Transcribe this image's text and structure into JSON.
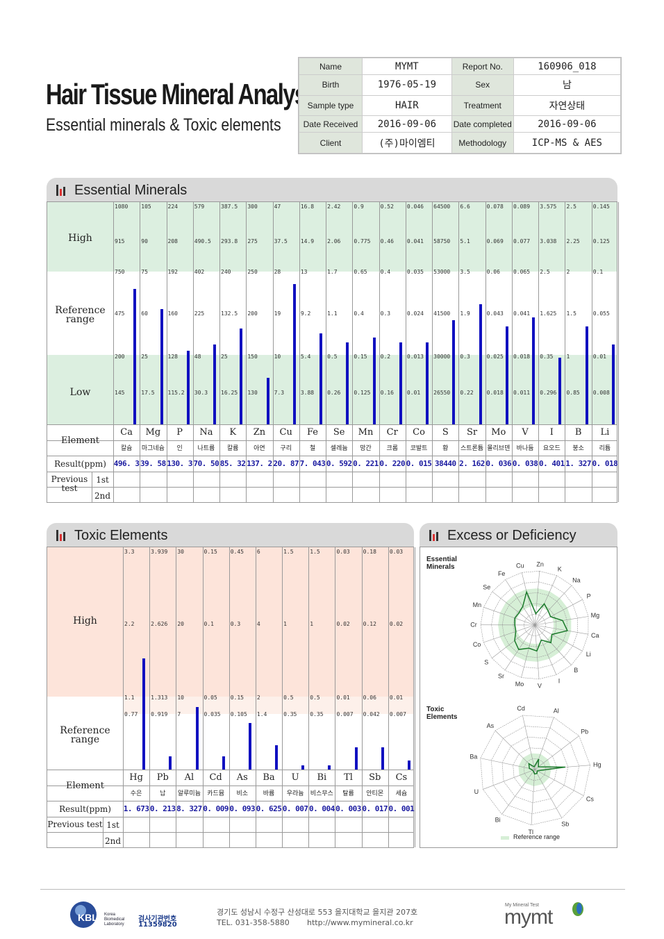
{
  "header": {
    "title": "Hair Tissue Mineral Analysis",
    "subtitle": "Essential minerals & Toxic elements"
  },
  "info": {
    "name_label": "Name",
    "name": "MYMT",
    "report_label": "Report No.",
    "report": "160906_018",
    "birth_label": "Birth",
    "birth": "1976-05-19",
    "sex_label": "Sex",
    "sex": "남",
    "sample_label": "Sample type",
    "sample": "HAIR",
    "treatment_label": "Treatment",
    "treatment": "자연상태",
    "received_label": "Date Received",
    "received": "2016-09-06",
    "completed_label": "Date completed",
    "completed": "2016-09-06",
    "client_label": "Client",
    "client": "(주)마이엠티",
    "method_label": "Methodology",
    "method": "ICP-MS & AES"
  },
  "essential": {
    "section_title": "Essential Minerals",
    "row_high": "High",
    "row_ref": "Reference range",
    "row_low": "Low",
    "row_element": "Element",
    "row_result": "Result(ppm)",
    "row_prev": "Previous test",
    "prev_1": "1st",
    "prev_2": "2nd",
    "elements": [
      {
        "sym": "Ca",
        "kor": "칼슘",
        "ticks": [
          "1080",
          "915",
          "750",
          "475",
          "200",
          "145"
        ],
        "result": "496. 3",
        "level": 0.61
      },
      {
        "sym": "Mg",
        "kor": "마그네슘",
        "ticks": [
          "105",
          "90",
          "75",
          "60",
          "25",
          "17.5"
        ],
        "result": "39. 58",
        "level": 0.52
      },
      {
        "sym": "P",
        "kor": "인",
        "ticks": [
          "224",
          "208",
          "192",
          "160",
          "128",
          "115.2"
        ],
        "result": "130. 3",
        "level": 0.33
      },
      {
        "sym": "Na",
        "kor": "나트륨",
        "ticks": [
          "579",
          "490.5",
          "402",
          "225",
          "48",
          "30.3"
        ],
        "result": "70. 50",
        "level": 0.36
      },
      {
        "sym": "K",
        "kor": "칼륨",
        "ticks": [
          "387.5",
          "293.8",
          "240",
          "132.5",
          "25",
          "16.25"
        ],
        "result": "85. 32",
        "level": 0.43
      },
      {
        "sym": "Zn",
        "kor": "아연",
        "ticks": [
          "300",
          "275",
          "250",
          "200",
          "150",
          "130"
        ],
        "result": "137. 2",
        "level": 0.21
      },
      {
        "sym": "Cu",
        "kor": "구리",
        "ticks": [
          "47",
          "37.5",
          "28",
          "19",
          "10",
          "7.3"
        ],
        "result": "20. 87",
        "level": 0.63
      },
      {
        "sym": "Fe",
        "kor": "철",
        "ticks": [
          "16.8",
          "14.9",
          "13",
          "9.2",
          "5.4",
          "3.88"
        ],
        "result": "7. 043",
        "level": 0.41
      },
      {
        "sym": "Se",
        "kor": "셀레늄",
        "ticks": [
          "2.42",
          "2.06",
          "1.7",
          "1.1",
          "0.5",
          "0.26"
        ],
        "result": "0. 592",
        "level": 0.37
      },
      {
        "sym": "Mn",
        "kor": "망간",
        "ticks": [
          "0.9",
          "0.775",
          "0.65",
          "0.4",
          "0.15",
          "0.125"
        ],
        "result": "0. 221",
        "level": 0.39
      },
      {
        "sym": "Cr",
        "kor": "크롬",
        "ticks": [
          "0.52",
          "0.46",
          "0.4",
          "0.3",
          "0.2",
          "0.16"
        ],
        "result": "0. 220",
        "level": 0.37
      },
      {
        "sym": "Co",
        "kor": "코발트",
        "ticks": [
          "0.046",
          "0.041",
          "0.035",
          "0.024",
          "0.013",
          "0.01"
        ],
        "result": "0. 015",
        "level": 0.37
      },
      {
        "sym": "S",
        "kor": "황",
        "ticks": [
          "64500",
          "58750",
          "53000",
          "41500",
          "30000",
          "26550"
        ],
        "result": "38440",
        "level": 0.47
      },
      {
        "sym": "Sr",
        "kor": "스트론튬",
        "ticks": [
          "6.6",
          "5.1",
          "3.5",
          "1.9",
          "0.3",
          "0.22"
        ],
        "result": "2. 162",
        "level": 0.54
      },
      {
        "sym": "Mo",
        "kor": "몰리브덴",
        "ticks": [
          "0.078",
          "0.069",
          "0.06",
          "0.043",
          "0.025",
          "0.018"
        ],
        "result": "0. 036",
        "level": 0.44
      },
      {
        "sym": "V",
        "kor": "바나듐",
        "ticks": [
          "0.089",
          "0.077",
          "0.065",
          "0.041",
          "0.018",
          "0.011"
        ],
        "result": "0. 038",
        "level": 0.48
      },
      {
        "sym": "I",
        "kor": "요오드",
        "ticks": [
          "3.575",
          "3.038",
          "2.5",
          "1.625",
          "0.35",
          "0.296"
        ],
        "result": "0. 401",
        "level": 0.3
      },
      {
        "sym": "B",
        "kor": "붕소",
        "ticks": [
          "2.5",
          "2.25",
          "2",
          "1.5",
          "1",
          "0.85"
        ],
        "result": "1. 327",
        "level": 0.44
      },
      {
        "sym": "Li",
        "kor": "리튬",
        "ticks": [
          "0.145",
          "0.125",
          "0.1",
          "0.055",
          "0.01",
          "0.008"
        ],
        "result": "0. 018",
        "level": 0.36
      }
    ]
  },
  "toxic": {
    "section_title": "Toxic Elements",
    "row_high": "High",
    "row_ref": "Reference range",
    "row_element": "Element",
    "row_result": "Result(ppm)",
    "row_prev": "Previous test",
    "prev_1": "1st",
    "prev_2": "2nd",
    "elements": [
      {
        "sym": "Hg",
        "kor": "수은",
        "ticks": [
          "3.3",
          "2.2",
          "1.1",
          "0.77"
        ],
        "result": "1. 673",
        "level": 0.5
      },
      {
        "sym": "Pb",
        "kor": "납",
        "ticks": [
          "3.939",
          "2.626",
          "1.313",
          "0.919"
        ],
        "result": "0. 213",
        "level": 0.06
      },
      {
        "sym": "Al",
        "kor": "알루미늄",
        "ticks": [
          "30",
          "20",
          "10",
          "7"
        ],
        "result": "8. 327",
        "level": 0.28
      },
      {
        "sym": "Cd",
        "kor": "카드뮴",
        "ticks": [
          "0.15",
          "0.1",
          "0.05",
          "0.035"
        ],
        "result": "0. 009",
        "level": 0.06
      },
      {
        "sym": "As",
        "kor": "비소",
        "ticks": [
          "0.45",
          "0.3",
          "0.15",
          "0.105"
        ],
        "result": "0. 093",
        "level": 0.21
      },
      {
        "sym": "Ba",
        "kor": "바륨",
        "ticks": [
          "6",
          "4",
          "2",
          "1.4"
        ],
        "result": "0. 625",
        "level": 0.11
      },
      {
        "sym": "U",
        "kor": "우라늄",
        "ticks": [
          "1.5",
          "1",
          "0.5",
          "0.35"
        ],
        "result": "0. 007",
        "level": 0.02
      },
      {
        "sym": "Bi",
        "kor": "비스무스",
        "ticks": [
          "1.5",
          "1",
          "0.5",
          "0.35"
        ],
        "result": "0. 004",
        "level": 0.02
      },
      {
        "sym": "Tl",
        "kor": "탈륨",
        "ticks": [
          "0.03",
          "0.02",
          "0.01",
          "0.007"
        ],
        "result": "0. 003",
        "level": 0.1
      },
      {
        "sym": "Sb",
        "kor": "안티몬",
        "ticks": [
          "0.18",
          "0.12",
          "0.06",
          "0.042"
        ],
        "result": "0. 017",
        "level": 0.1
      },
      {
        "sym": "Cs",
        "kor": "세슘",
        "ticks": [
          "0.03",
          "0.02",
          "0.01",
          "0.007"
        ],
        "result": "0. 001",
        "level": 0.04
      }
    ]
  },
  "excess": {
    "section_title": "Excess or Deficiency",
    "essential_label": "Essential Minerals",
    "toxic_label": "Toxic Elements",
    "legend": "Reference range",
    "essential_axes": [
      "Zn",
      "K",
      "Na",
      "P",
      "Mg",
      "Ca",
      "Li",
      "B",
      "I",
      "V",
      "Mo",
      "Sr",
      "S",
      "Co",
      "Cr",
      "Mn",
      "Se",
      "Fe",
      "Cu"
    ],
    "essential_values": [
      0.21,
      0.43,
      0.36,
      0.33,
      0.52,
      0.61,
      0.36,
      0.44,
      0.3,
      0.48,
      0.44,
      0.54,
      0.47,
      0.37,
      0.37,
      0.39,
      0.37,
      0.41,
      0.63
    ],
    "toxic_axes": [
      "Al",
      "Pb",
      "Hg",
      "Cs",
      "Sb",
      "Tl",
      "Bi",
      "U",
      "Ba",
      "As",
      "Cd"
    ],
    "toxic_values": [
      0.2,
      0.08,
      0.55,
      0.05,
      0.08,
      0.08,
      0.04,
      0.04,
      0.1,
      0.15,
      0.05
    ]
  },
  "footer": {
    "lab_name": "KBL",
    "lab_full": "Korea Biomedical Laboratory",
    "cert_label": "검사기관번호",
    "cert_no": "11359820",
    "address": "경기도 성남시 수정구 산성대로 553 을지대학교 을지관 207호",
    "tel": "TEL. 031-358-5880",
    "url": "http://www.mymineral.co.kr",
    "brand_small": "My Mineral Test",
    "brand": "mymt"
  }
}
